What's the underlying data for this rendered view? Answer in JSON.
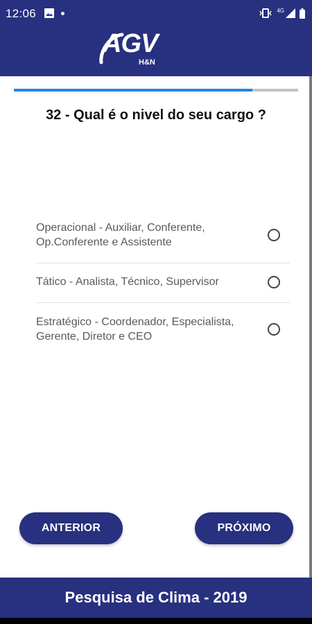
{
  "status_bar": {
    "time": "12:06",
    "network_label": "4G",
    "icons": [
      "image-icon",
      "dot-icon",
      "vibrate-icon",
      "signal-icon",
      "battery-icon"
    ]
  },
  "header": {
    "logo_main": "AGV",
    "logo_sub": "H&N"
  },
  "progress": {
    "fraction": 0.84
  },
  "question": {
    "text": "32 - Qual é o nivel do seu cargo ?"
  },
  "options": [
    {
      "label": "Operacional - Auxiliar, Conferente, Op.Conferente e Assistente",
      "selected": false
    },
    {
      "label": "Tático - Analista, Técnico, Supervisor",
      "selected": false
    },
    {
      "label": "Estratégico - Coordenador, Especialista, Gerente, Diretor e CEO",
      "selected": false
    }
  ],
  "buttons": {
    "previous": "ANTERIOR",
    "next": "PRÓXIMO"
  },
  "footer": {
    "title": "Pesquisa de Clima - 2019"
  },
  "colors": {
    "brand": "#283080",
    "progress": "#1e88e5",
    "track": "#c4c4c4"
  }
}
